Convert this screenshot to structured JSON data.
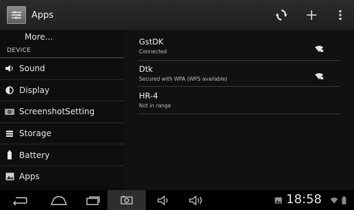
{
  "topbar": {
    "title": "Apps"
  },
  "left": {
    "more_label": "More...",
    "section_header": "DEVICE",
    "items": [
      {
        "label": "Sound",
        "icon": "sound-icon"
      },
      {
        "label": "Display",
        "icon": "display-icon"
      },
      {
        "label": "ScreenshotSetting",
        "icon": "camera-icon"
      },
      {
        "label": "Storage",
        "icon": "storage-icon"
      },
      {
        "label": "Battery",
        "icon": "battery-icon"
      },
      {
        "label": "Apps",
        "icon": "apps-icon"
      }
    ]
  },
  "networks": [
    {
      "ssid": "GstDK",
      "status": "Connected"
    },
    {
      "ssid": "Dtk",
      "status": "Secured with WPA (WPS available)"
    },
    {
      "ssid": "HR-4",
      "status": "Not in range"
    }
  ],
  "statusbar": {
    "time": "18:58"
  }
}
